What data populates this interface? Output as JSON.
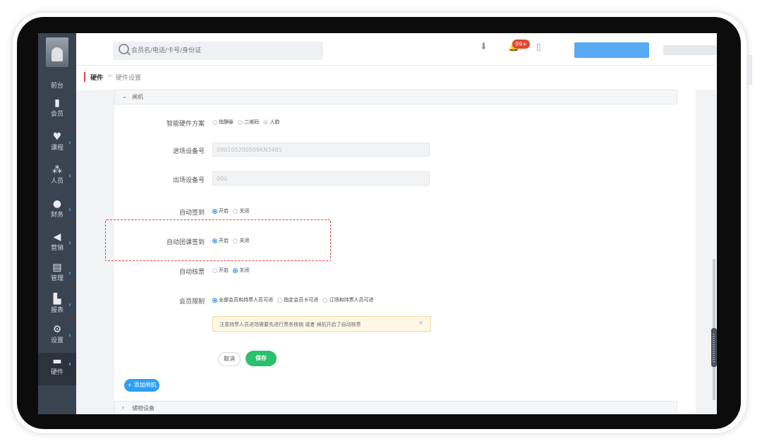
{
  "sidebar": {
    "items": [
      {
        "label": "前台",
        "icon": "home-icon"
      },
      {
        "label": "会员",
        "icon": "member-icon"
      },
      {
        "label": "课程",
        "icon": "course-icon"
      },
      {
        "label": "人员",
        "icon": "staff-icon"
      },
      {
        "label": "财务",
        "icon": "finance-icon"
      },
      {
        "label": "营销",
        "icon": "marketing-icon"
      },
      {
        "label": "管理",
        "icon": "management-icon"
      },
      {
        "label": "报表",
        "icon": "report-icon"
      },
      {
        "label": "设置",
        "icon": "settings-icon"
      },
      {
        "label": "硬件",
        "icon": "hardware-icon"
      }
    ]
  },
  "topbar": {
    "search_placeholder": "会员名/电话/卡号/身份证",
    "badge": "99+"
  },
  "breadcrumb": {
    "root": "硬件",
    "sep": ">",
    "current": "硬件设置"
  },
  "panel": {
    "title": "闸机",
    "fields": {
      "scheme": {
        "label": "智能硬件方案",
        "options": [
          "指静脉",
          "二维码",
          "人脸"
        ],
        "selected": "人脸"
      },
      "entry_device": {
        "label": "进场设备号",
        "value": "090105200509KN3485"
      },
      "exit_device": {
        "label": "出场设备号",
        "value": "000"
      },
      "auto_checkin": {
        "label": "自动签到",
        "options": [
          "开启",
          "关闭"
        ],
        "selected": "开启"
      },
      "auto_group_checkin": {
        "label": "自动团课签到",
        "options": [
          "开启",
          "关闭"
        ],
        "selected": "开启"
      },
      "auto_ticket": {
        "label": "自动核票",
        "options": [
          "开启",
          "关闭"
        ],
        "selected": "关闭"
      },
      "member_limit": {
        "label": "会员限制",
        "options": [
          "全部会员和持票人员可进",
          "指定会员卡可进",
          "订场和持票人员可进"
        ],
        "selected": "全部会员和持票人员可进"
      }
    },
    "notice": "注意持票人员进场需要先进行票务核销 或者 闸机开启了自动核票",
    "notice_close": "×",
    "cancel": "取消",
    "save": "保存",
    "add": "+ 添加闸机",
    "next_section": "储物设备"
  }
}
